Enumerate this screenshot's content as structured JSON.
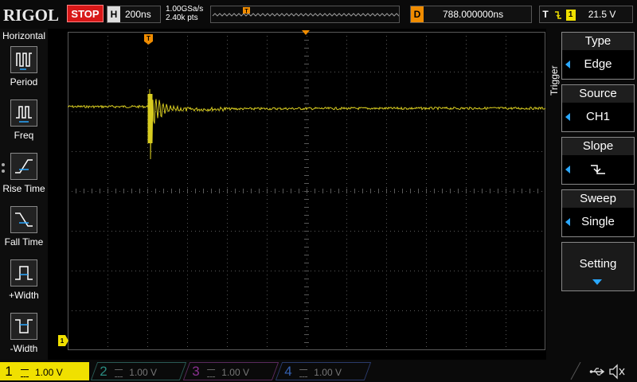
{
  "header": {
    "logo": "RIGOL",
    "run_state": "STOP",
    "timebase_key": "H",
    "timebase_value": "200ns",
    "sample_rate": "1.00GSa/s",
    "memory_depth": "2.40k pts",
    "delay_key": "D",
    "delay_value": "788.000000ns",
    "trigger_key": "T",
    "trigger_channel": "1",
    "trigger_level": "21.5 V"
  },
  "left_menu": {
    "title": "Horizontal",
    "items": [
      {
        "label": "Period",
        "icon": "period-icon"
      },
      {
        "label": "Freq",
        "icon": "freq-icon"
      },
      {
        "label": "Rise Time",
        "icon": "rise-time-icon"
      },
      {
        "label": "Fall Time",
        "icon": "fall-time-icon"
      },
      {
        "label": "+Width",
        "icon": "positive-width-icon"
      },
      {
        "label": "-Width",
        "icon": "negative-width-icon"
      }
    ]
  },
  "right_menu": {
    "title": "Trigger",
    "buttons": [
      {
        "title": "Type",
        "value": "Edge"
      },
      {
        "title": "Source",
        "value": "CH1"
      },
      {
        "title": "Slope",
        "value": ""
      },
      {
        "title": "Sweep",
        "value": "Single"
      }
    ],
    "setting_label": "Setting"
  },
  "channels": [
    {
      "number": "1",
      "scale": "1.00 V",
      "active": true,
      "color": "#f0e000"
    },
    {
      "number": "2",
      "scale": "1.00 V",
      "active": false,
      "color": "#00c8b4"
    },
    {
      "number": "3",
      "scale": "1.00 V",
      "active": false,
      "color": "#c03cc8"
    },
    {
      "number": "4",
      "scale": "1.00 V",
      "active": false,
      "color": "#3c78ff"
    }
  ],
  "screen_markers": {
    "trigger_marker": "T",
    "ground_marker": "1"
  },
  "colors": {
    "trace": "#d8cc20",
    "grid": "#5a5a5a",
    "accent": "#f08c00",
    "stop": "#d81818",
    "arrow": "#2aa8ff"
  }
}
